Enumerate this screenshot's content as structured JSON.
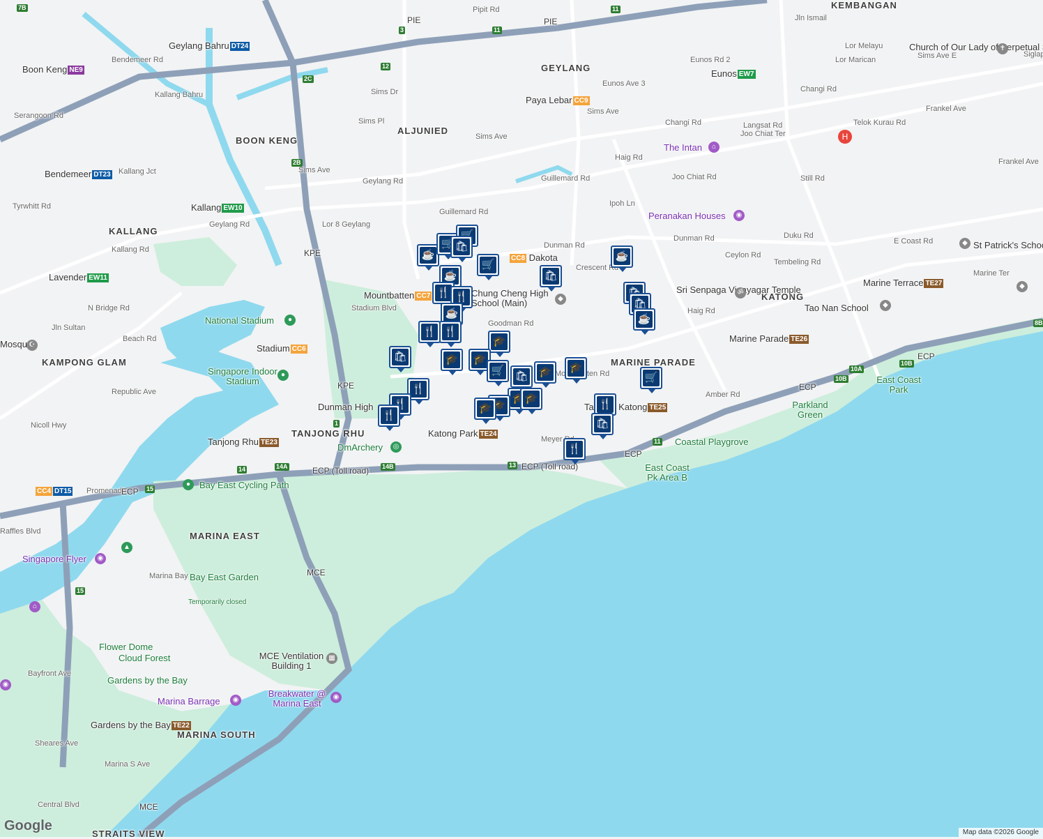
{
  "map": {
    "colors": {
      "water": "#8fd9ee",
      "park": "#cdeedc",
      "land": "#f2f3f4",
      "road": "#ffffff",
      "highway": "#8ea0b8",
      "mrt": "#7b4ba0",
      "pin": "#0b3a73"
    },
    "areas": [
      "GEYLANG",
      "ALJUNIED",
      "BOON KENG",
      "KALLANG",
      "KAMPONG GLAM",
      "TANJONG RHU",
      "MARINA EAST",
      "MARINE PARADE",
      "KATONG",
      "MARINA SOUTH",
      "STRAITS VIEW",
      "KEMBANGAN"
    ],
    "roads": [
      "Pipit Rd",
      "Sims Dr",
      "Sims Pl",
      "Sims Ave",
      "Geylang Rd",
      "Guillemard Rd",
      "Dunman Rd",
      "Crescent Rd",
      "Haig Rd",
      "Ipoh Ln",
      "Joo Chiat Rd",
      "Goodman Rd",
      "Mountbatten Rd",
      "Meyer Rd",
      "Amber Rd",
      "Ceylon Rd",
      "Tembeling Rd",
      "Duku Rd",
      "Langsat Rd",
      "Joo Chiat Ter",
      "Changi Rd",
      "Sims Ave E",
      "Frankel Ave",
      "Still Rd",
      "Telok Kurau Rd",
      "Lor Marican",
      "Lor Melayu",
      "Jln Ismail",
      "Eunos Ave 3",
      "Eunos Rd 2",
      "Siglap Rd",
      "E Coast Rd",
      "Marine Ter",
      "Kallang Rd",
      "Kallang Bahru",
      "Kallang Jct",
      "Bendemeer Rd",
      "Serangoon Rd",
      "Geylang Bahru",
      "Tyrwhitt Rd",
      "N Bridge Rd",
      "Jln Sultan",
      "Beach Rd",
      "Republic Ave",
      "Nicoll Hwy",
      "Stadium Blvd",
      "Lor 8 Geylang",
      "Raffles Blvd",
      "Bayfront Ave",
      "Sheares Ave",
      "Central Blvd",
      "Marina S Ave",
      "Marina Bay",
      "Promenade",
      "Lor 8 Geylang"
    ],
    "highways": [
      "PIE",
      "KPE",
      "ECP (Toll road)",
      "ECP",
      "MCE"
    ],
    "stations": [
      {
        "name": "Geylang Bahru",
        "code": "DT24",
        "color": "#0d5ba6"
      },
      {
        "name": "Boon Keng",
        "code": "NE9",
        "color": "#8b3a9e"
      },
      {
        "name": "Bendemeer",
        "code": "DT23",
        "color": "#0d5ba6"
      },
      {
        "name": "Kallang",
        "code": "EW10",
        "color": "#1f9b4a"
      },
      {
        "name": "Lavender",
        "code": "EW11",
        "color": "#1f9b4a"
      },
      {
        "name": "Stadium",
        "code": "CC6",
        "color": "#f4a43b"
      },
      {
        "name": "Mountbatten",
        "code": "CC7",
        "color": "#f4a43b"
      },
      {
        "name": "Dakota",
        "code": "CC8",
        "color": "#f4a43b"
      },
      {
        "name": "Paya Lebar",
        "code": "CC9",
        "color": "#f4a43b"
      },
      {
        "name": "Eunos",
        "code": "EW7",
        "color": "#1f9b4a"
      },
      {
        "name": "Tanjong Rhu",
        "code": "TE23",
        "color": "#8a5a2b"
      },
      {
        "name": "Katong Park",
        "code": "TE24",
        "color": "#8a5a2b"
      },
      {
        "name": "Tanjong Katong",
        "code": "TE25",
        "color": "#8a5a2b"
      },
      {
        "name": "Marine Parade",
        "code": "TE26",
        "color": "#8a5a2b"
      },
      {
        "name": "Marine Terrace",
        "code": "TE27",
        "color": "#8a5a2b"
      },
      {
        "name": "Gardens by the Bay",
        "code": "TE22",
        "color": "#8a5a2b"
      }
    ],
    "pois": [
      "The Intan",
      "Peranakan Houses",
      "Sri Senpaga Vinayagar Temple",
      "Church of Our Lady of Perpetual Succour",
      "St Patrick's School",
      "Tao Nan School",
      "Chung Cheng High School (Main)",
      "National Stadium",
      "Singapore Indoor Stadium",
      "Dunman High",
      "DmArchery",
      "Bay East Cycling Path",
      "Singapore Flyer",
      "Bay East Garden",
      "Temporarily closed",
      "Flower Dome",
      "Cloud Forest",
      "Gardens by the Bay",
      "MCE Ventilation Building 1",
      "Marina Barrage",
      "Breakwater @ Marina East",
      "Coastal Playgrove",
      "East Coast Pk Area B",
      "Parkland Green",
      "East Coast Park",
      "Mosque"
    ]
  },
  "footer": {
    "logo": "Google",
    "copyright": "Map data ©2026 Google"
  }
}
